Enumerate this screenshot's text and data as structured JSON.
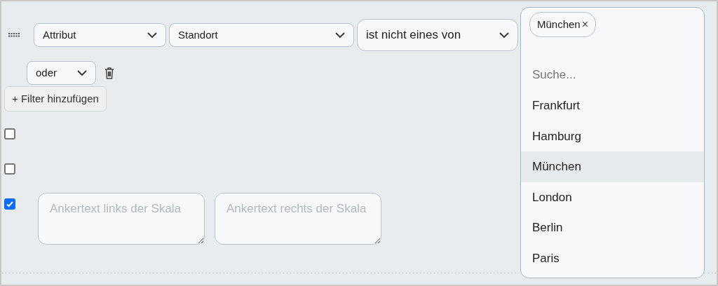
{
  "filter_row": {
    "type_select": "Attribut",
    "field_select": "Standort",
    "operator_select": "ist nicht eines von",
    "connector_select": "oder"
  },
  "add_filter_button": "+ Filter hinzufügen",
  "checkboxes": [
    {
      "checked": false
    },
    {
      "checked": false
    },
    {
      "checked": true
    }
  ],
  "anchor_fields": [
    {
      "placeholder": "Ankertext links der Skala"
    },
    {
      "placeholder": "Ankertext rechts der Skala"
    }
  ],
  "dropdown": {
    "tags": [
      {
        "label": "München",
        "remove": "×"
      }
    ],
    "search_placeholder": "Suche...",
    "options": [
      {
        "label": "Frankfurt",
        "selected": false
      },
      {
        "label": "Hamburg",
        "selected": false
      },
      {
        "label": "München",
        "selected": true
      },
      {
        "label": "London",
        "selected": false
      },
      {
        "label": "Berlin",
        "selected": false
      },
      {
        "label": "Paris",
        "selected": false
      }
    ]
  }
}
